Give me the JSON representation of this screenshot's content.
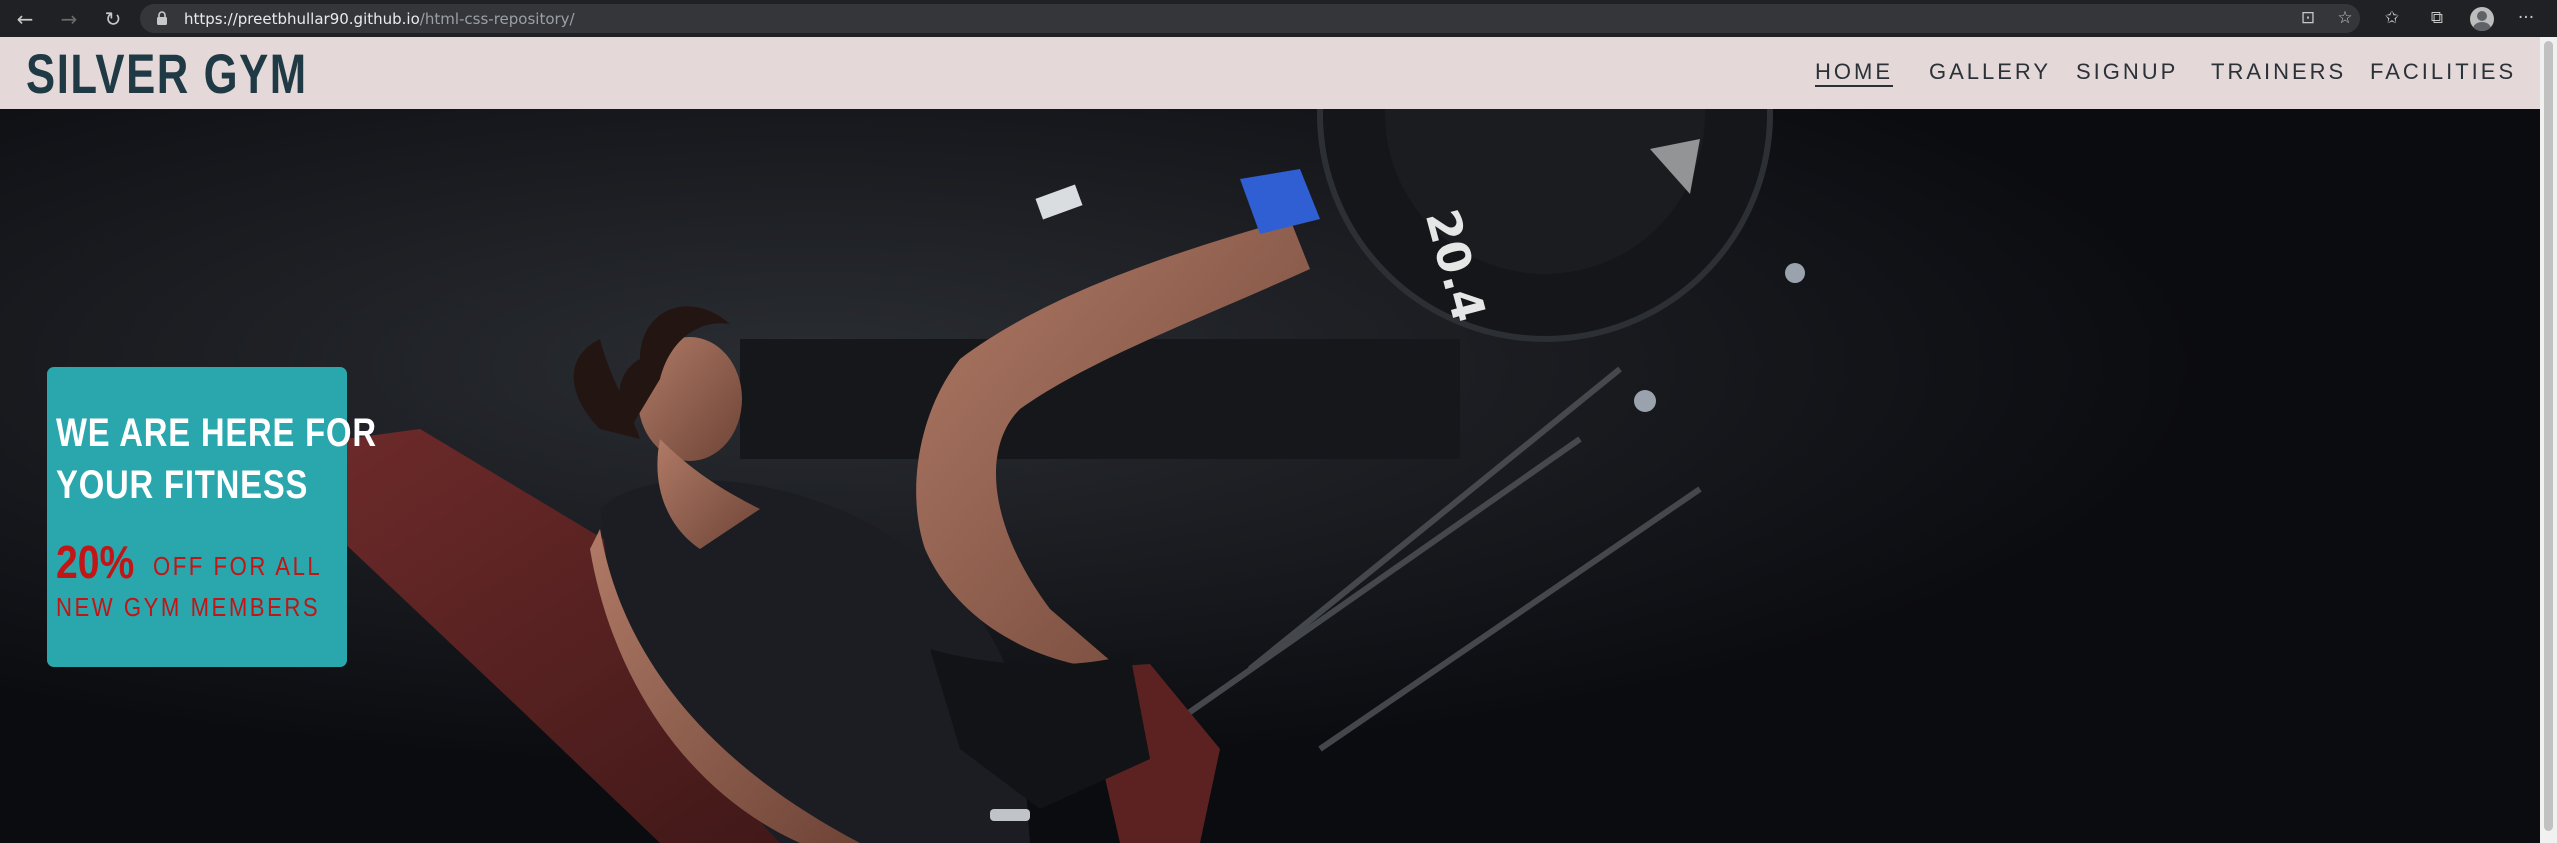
{
  "browser": {
    "back_icon": "arrow-left-icon",
    "forward_icon": "arrow-right-icon",
    "reload_icon": "reload-icon",
    "url_host": "https://preetbhullar90.github.io",
    "url_path": "/html-css-repository/",
    "menu_label": "···"
  },
  "site": {
    "logo": "SILVER GYM",
    "nav": [
      {
        "label": "HOME",
        "active": true
      },
      {
        "label": "GALLERY",
        "active": false
      },
      {
        "label": "SIGNUP",
        "active": false
      },
      {
        "label": "TRAINERS",
        "active": false
      },
      {
        "label": "FACILITIES",
        "active": false
      }
    ]
  },
  "hero": {
    "promo_line1": "WE ARE HERE FOR",
    "promo_line2": "YOUR FITNESS",
    "discount": "20%",
    "offer_line1": "OFF FOR ALL",
    "offer_line2": "NEW GYM MEMBERS",
    "plate_label": "20.4"
  },
  "colors": {
    "header_bg": "#e4d8d9",
    "logo_color": "#1f3a44",
    "promo_bg": "#2aa6ad",
    "promo_accent": "#c21515"
  }
}
